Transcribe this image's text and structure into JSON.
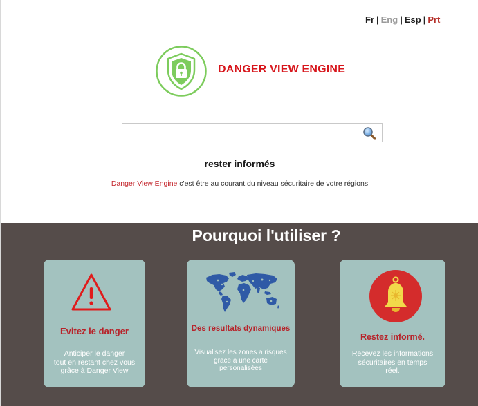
{
  "languages": {
    "items": [
      {
        "code": "fr",
        "label": "Fr"
      },
      {
        "code": "eng",
        "label": "Eng"
      },
      {
        "code": "esp",
        "label": "Esp"
      },
      {
        "code": "prt",
        "label": "Prt"
      }
    ],
    "separator": "|"
  },
  "brand": {
    "title": "DANGER VIEW ENGINE",
    "logo_icon": "shield-lock-icon",
    "color": "#d7161c"
  },
  "search": {
    "value": "",
    "placeholder": "",
    "icon": "search-icon"
  },
  "intro": {
    "headline": "rester informés",
    "tagline_brand": "Danger View Engine",
    "tagline_rest": " c'est être au courant du niveau sécuritaire de votre régions"
  },
  "why": {
    "title": "Pourquoi l'utiliser ?",
    "cards": [
      {
        "icon": "warning-triangle-icon",
        "title": "Evitez le danger",
        "lines": [
          "Anticiper le danger",
          "tout en restant chez vous",
          "grâce à Danger View"
        ]
      },
      {
        "icon": "world-map-icon",
        "title": "Des resultats dynamiques",
        "lines": [
          "Visualisez les zones a risques",
          "grace a une carte",
          "personalisées"
        ]
      },
      {
        "icon": "bell-icon",
        "title": "Restez informé.",
        "lines": [
          "Recevez les informations",
          "sécuritaires en temps",
          "réel."
        ]
      }
    ]
  },
  "colors": {
    "accent_red": "#d7161c",
    "dark_section": "#554c4a",
    "card_bg": "#a3c2bf",
    "logo_green": "#7dcc5d"
  }
}
